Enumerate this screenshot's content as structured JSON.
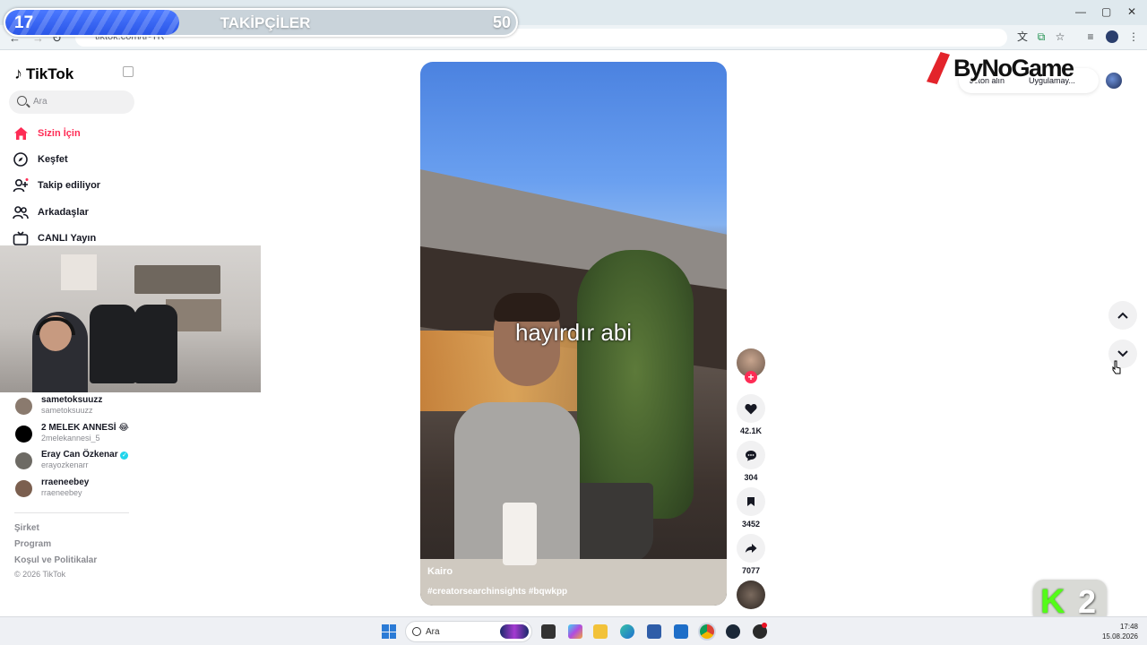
{
  "browser": {
    "url": "tiktok.com/tr-TR",
    "window_controls": [
      "—",
      "▢",
      "✕"
    ]
  },
  "followers_goal": {
    "current": "17",
    "title": "TAKİPÇİLER",
    "goal": "50",
    "progress": 0.34,
    "fill_color": "#2a56e8"
  },
  "sidebar": {
    "logo": "TikTok",
    "search_placeholder": "Ara",
    "nav": [
      {
        "label": "Sizin İçin",
        "icon": "home-icon",
        "active": true
      },
      {
        "label": "Keşfet",
        "icon": "compass-icon"
      },
      {
        "label": "Takip ediliyor",
        "icon": "following-icon"
      },
      {
        "label": "Arkadaşlar",
        "icon": "friends-icon"
      },
      {
        "label": "CANLI Yayın",
        "icon": "live-icon"
      }
    ],
    "accounts": [
      {
        "name": "sametoksuuzz",
        "handle": "sametoksuuzz"
      },
      {
        "name": "2 MELEK ANNESİ 😂",
        "handle": "2melekannesi_5"
      },
      {
        "name": "Eray Can Özkenar",
        "handle": "erayozkenarr",
        "verified": true
      },
      {
        "name": "rraeneebey",
        "handle": "rraeneebey"
      }
    ],
    "footer_links": [
      "Şirket",
      "Program",
      "Koşul ve Politikalar"
    ],
    "copyright": "© 2026 TikTok"
  },
  "video": {
    "caption": "hayırdır abi",
    "author": "Kairo",
    "tags": "#creatorsearchinsights #bqwkpp"
  },
  "actions": {
    "likes": "42.1K",
    "comments": "304",
    "saves": "3452",
    "shares": "7077"
  },
  "top_right": {
    "coin_label": "Jeton alın",
    "app_label": "Uygulamay...",
    "brand": "ByNoGame"
  },
  "k2_logo": {
    "letter": "K",
    "number": "2"
  },
  "taskbar": {
    "search_placeholder": "Ara",
    "time": "17:48",
    "date": "15.08.2026"
  },
  "colors": {
    "tiktok_accent": "#fe2c55",
    "kick_green": "#53fc18"
  }
}
